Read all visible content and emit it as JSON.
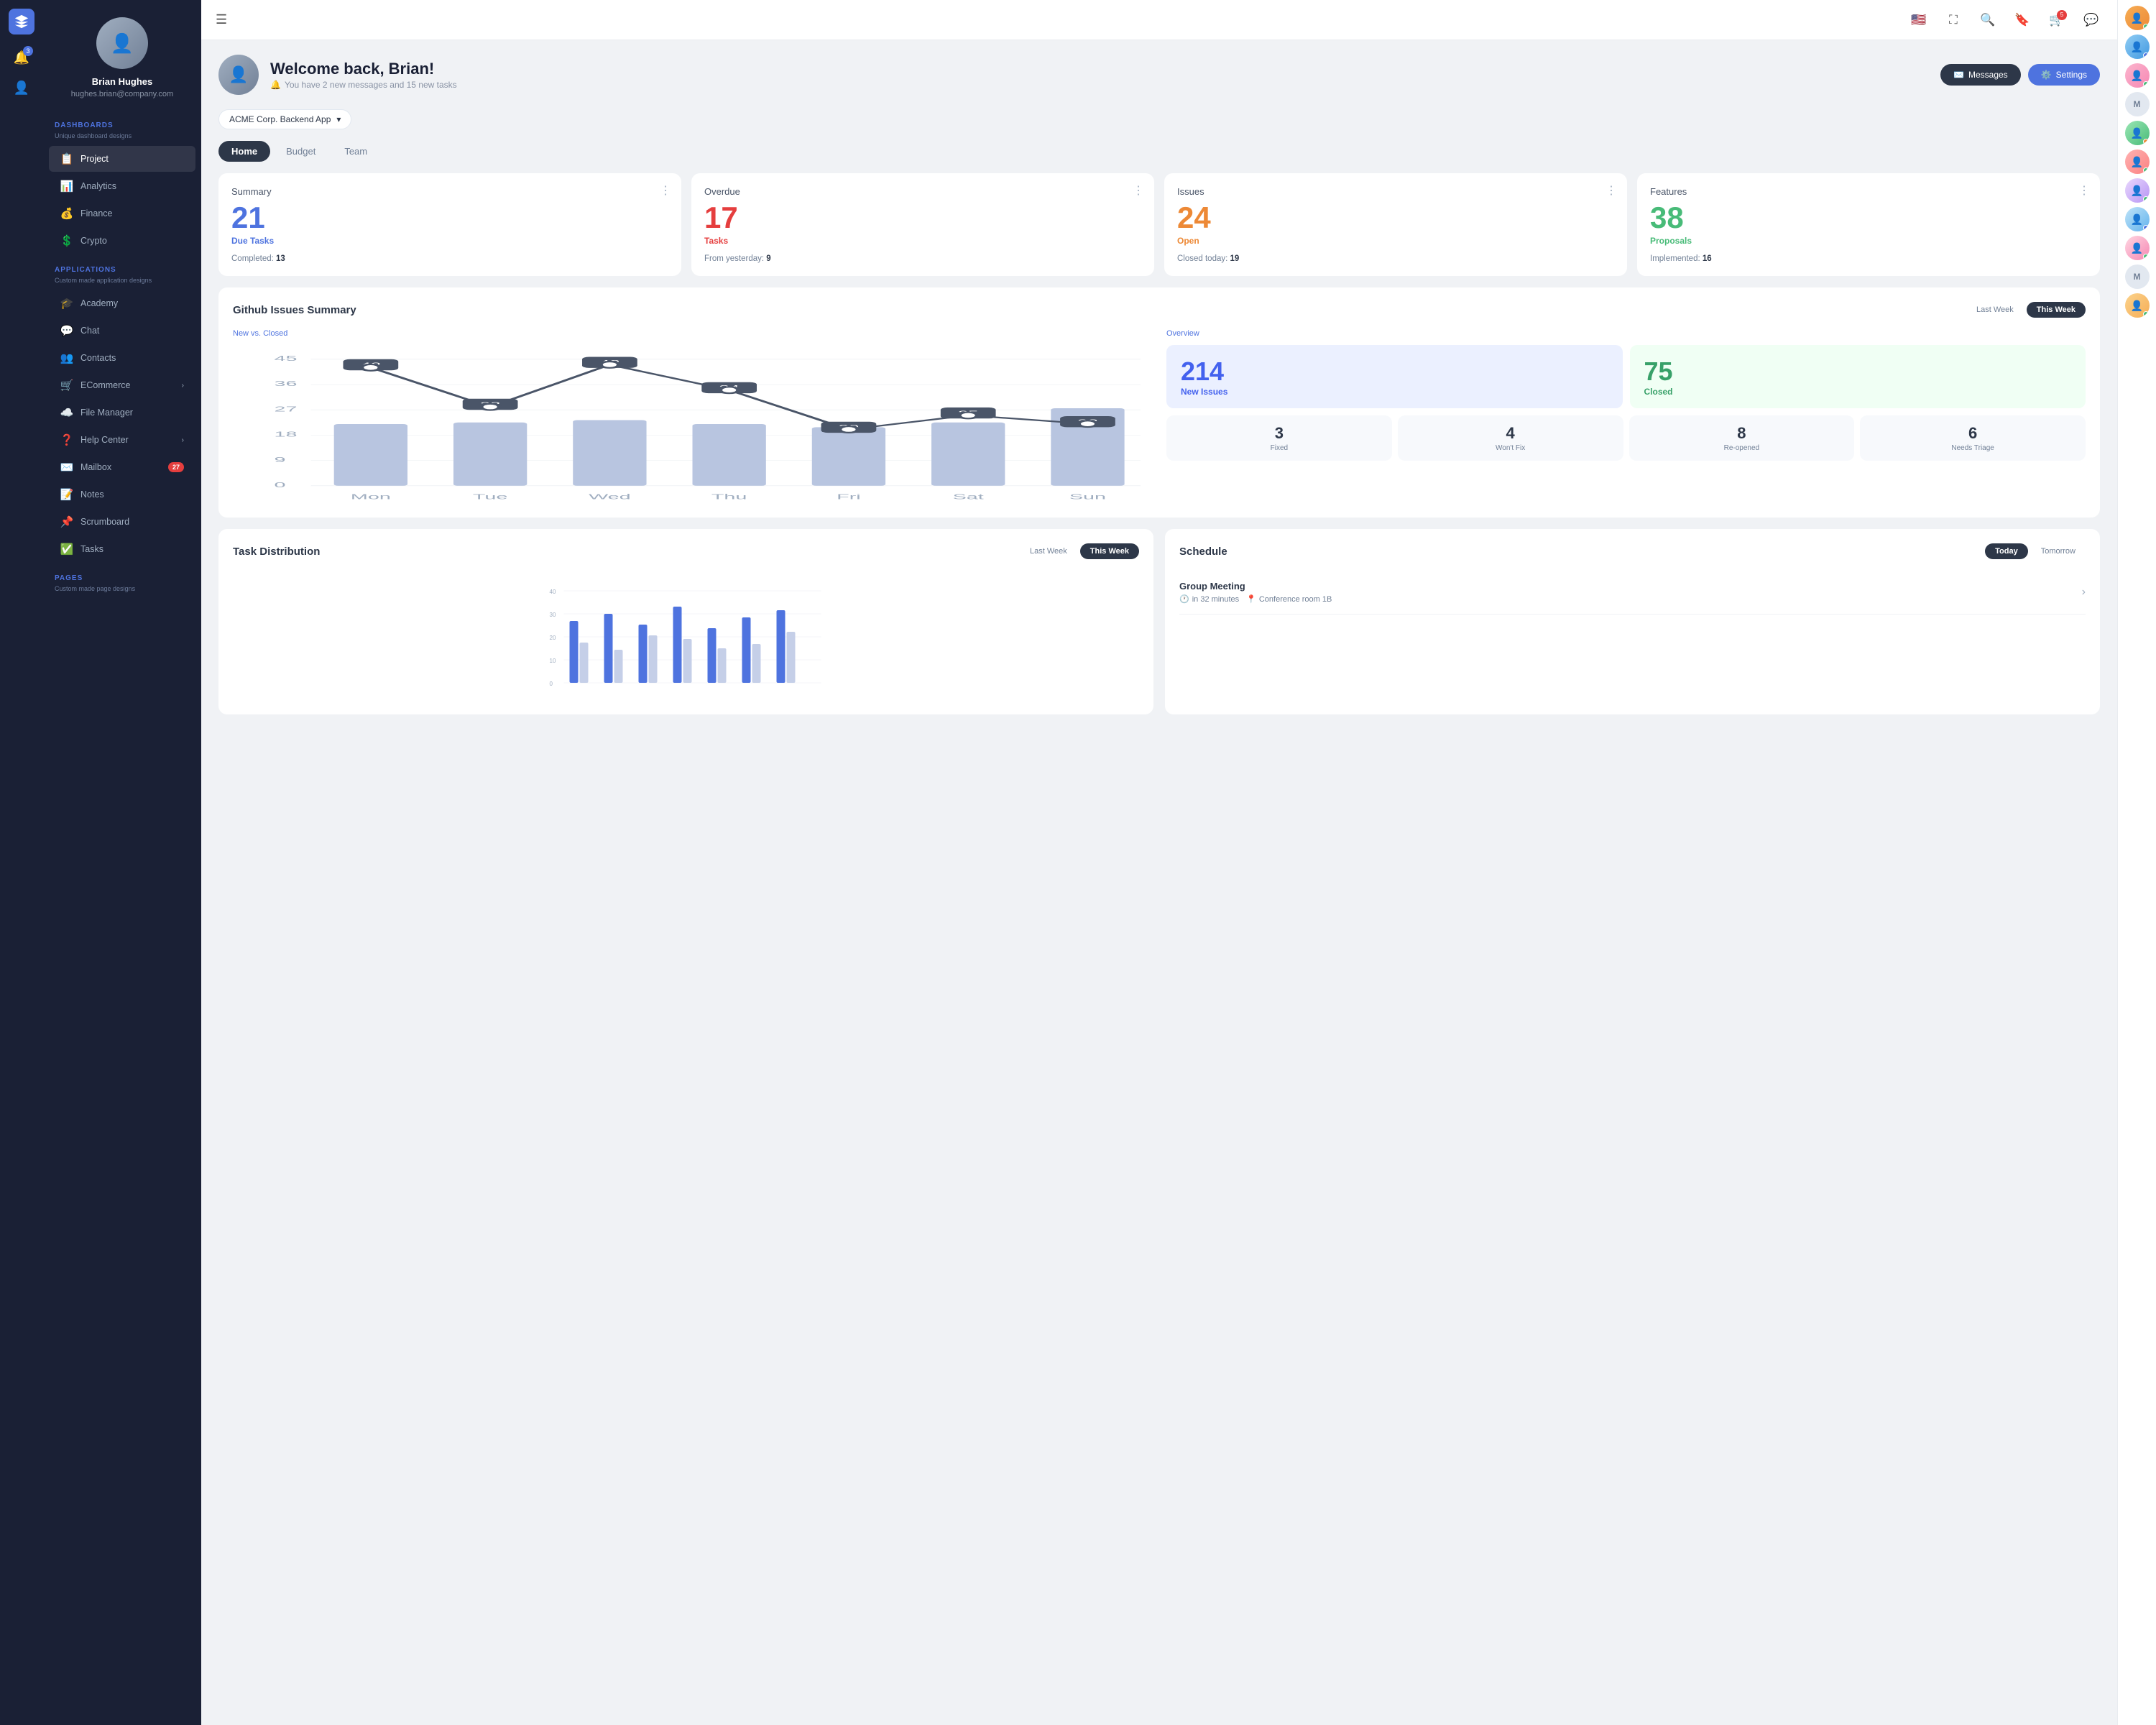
{
  "app": {
    "logo": "diamond",
    "notifications_count": "3"
  },
  "sidebar": {
    "user": {
      "name": "Brian Hughes",
      "email": "hughes.brian@company.com"
    },
    "dashboards_label": "DASHBOARDS",
    "dashboards_sub": "Unique dashboard designs",
    "nav_items": [
      {
        "id": "project",
        "label": "Project",
        "icon": "📋",
        "active": true
      },
      {
        "id": "analytics",
        "label": "Analytics",
        "icon": "📊",
        "active": false
      },
      {
        "id": "finance",
        "label": "Finance",
        "icon": "💰",
        "active": false
      },
      {
        "id": "crypto",
        "label": "Crypto",
        "icon": "💲",
        "active": false
      }
    ],
    "apps_label": "APPLICATIONS",
    "apps_sub": "Custom made application designs",
    "app_items": [
      {
        "id": "academy",
        "label": "Academy",
        "icon": "🎓"
      },
      {
        "id": "chat",
        "label": "Chat",
        "icon": "💬"
      },
      {
        "id": "contacts",
        "label": "Contacts",
        "icon": "👥"
      },
      {
        "id": "ecommerce",
        "label": "ECommerce",
        "icon": "🛒",
        "hasChevron": true
      },
      {
        "id": "file-manager",
        "label": "File Manager",
        "icon": "☁️"
      },
      {
        "id": "help-center",
        "label": "Help Center",
        "icon": "❓",
        "hasChevron": true
      },
      {
        "id": "mailbox",
        "label": "Mailbox",
        "icon": "✉️",
        "badge": "27"
      },
      {
        "id": "notes",
        "label": "Notes",
        "icon": "📝"
      },
      {
        "id": "scrumboard",
        "label": "Scrumboard",
        "icon": "📌"
      },
      {
        "id": "tasks",
        "label": "Tasks",
        "icon": "✅"
      }
    ],
    "pages_label": "PAGES",
    "pages_sub": "Custom made page designs"
  },
  "topbar": {
    "messages_badge": "5"
  },
  "welcome": {
    "title": "Welcome back, Brian!",
    "subtitle": "You have 2 new messages and 15 new tasks",
    "messages_btn": "Messages",
    "settings_btn": "Settings"
  },
  "project_selector": {
    "label": "ACME Corp. Backend App"
  },
  "tabs": [
    {
      "id": "home",
      "label": "Home",
      "active": true
    },
    {
      "id": "budget",
      "label": "Budget",
      "active": false
    },
    {
      "id": "team",
      "label": "Team",
      "active": false
    }
  ],
  "stats": [
    {
      "id": "summary",
      "title": "Summary",
      "number": "21",
      "number_color": "blue",
      "label": "Due Tasks",
      "label_color": "blue",
      "sub_label": "Completed:",
      "sub_value": "13"
    },
    {
      "id": "overdue",
      "title": "Overdue",
      "number": "17",
      "number_color": "red",
      "label": "Tasks",
      "label_color": "red",
      "sub_label": "From yesterday:",
      "sub_value": "9"
    },
    {
      "id": "issues",
      "title": "Issues",
      "number": "24",
      "number_color": "orange",
      "label": "Open",
      "label_color": "orange",
      "sub_label": "Closed today:",
      "sub_value": "19"
    },
    {
      "id": "features",
      "title": "Features",
      "number": "38",
      "number_color": "green",
      "label": "Proposals",
      "label_color": "green",
      "sub_label": "Implemented:",
      "sub_value": "16"
    }
  ],
  "github_issues": {
    "title": "Github Issues Summary",
    "last_week_btn": "Last Week",
    "this_week_btn": "This Week",
    "chart_subtitle": "New vs. Closed",
    "chart_data": {
      "days": [
        "Mon",
        "Tue",
        "Wed",
        "Thu",
        "Fri",
        "Sat",
        "Sun"
      ],
      "line_values": [
        42,
        28,
        43,
        34,
        20,
        25,
        22
      ],
      "bar_heights": [
        65,
        70,
        75,
        68,
        62,
        72,
        90
      ]
    },
    "overview_label": "Overview",
    "new_issues_num": "214",
    "new_issues_label": "New Issues",
    "closed_num": "75",
    "closed_label": "Closed",
    "mini_stats": [
      {
        "num": "3",
        "label": "Fixed"
      },
      {
        "num": "4",
        "label": "Won't Fix"
      },
      {
        "num": "8",
        "label": "Re-opened"
      },
      {
        "num": "6",
        "label": "Needs Triage"
      }
    ]
  },
  "task_distribution": {
    "title": "Task Distribution",
    "last_week_btn": "Last Week",
    "this_week_btn": "This Week"
  },
  "schedule": {
    "title": "Schedule",
    "today_btn": "Today",
    "tomorrow_btn": "Tomorrow",
    "items": [
      {
        "title": "Group Meeting",
        "time": "in 32 minutes",
        "location": "Conference room 1B"
      }
    ]
  },
  "right_avatars": [
    {
      "id": "av1",
      "initials": "",
      "dot": "green"
    },
    {
      "id": "av2",
      "initials": "",
      "dot": "blue"
    },
    {
      "id": "av3",
      "initials": "",
      "dot": "green"
    },
    {
      "id": "av4",
      "initials": "M",
      "dot": ""
    },
    {
      "id": "av5",
      "initials": "",
      "dot": "orange"
    },
    {
      "id": "av6",
      "initials": "",
      "dot": "green"
    },
    {
      "id": "av7",
      "initials": "",
      "dot": "green"
    },
    {
      "id": "av8",
      "initials": "",
      "dot": "blue"
    },
    {
      "id": "av9",
      "initials": "",
      "dot": "green"
    },
    {
      "id": "av10",
      "initials": "M",
      "dot": ""
    },
    {
      "id": "av11",
      "initials": "",
      "dot": "green"
    }
  ]
}
